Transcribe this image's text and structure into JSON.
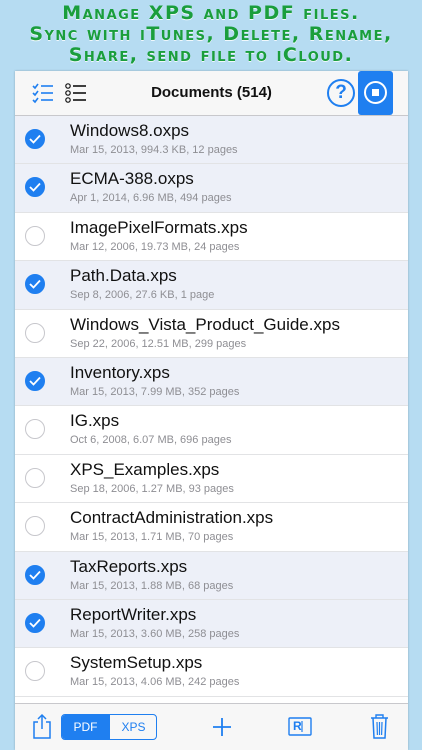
{
  "promo": {
    "line1": "Manage XPS and PDF files.",
    "line2": "Sync with iTunes, Delete, Rename,",
    "line3": "Share, send file to iCloud."
  },
  "header": {
    "title": "Documents (514)",
    "help_label": "?"
  },
  "files": [
    {
      "name": "Windows8.oxps",
      "meta": "Mar 15, 2013, 994.3 KB, 12 pages",
      "selected": true
    },
    {
      "name": "ECMA-388.oxps",
      "meta": "Apr 1, 2014, 6.96 MB, 494 pages",
      "selected": true
    },
    {
      "name": "ImagePixelFormats.xps",
      "meta": "Mar 12, 2006, 19.73 MB, 24 pages",
      "selected": false
    },
    {
      "name": "Path.Data.xps",
      "meta": "Sep 8, 2006, 27.6 KB, 1 page",
      "selected": true
    },
    {
      "name": "Windows_Vista_Product_Guide.xps",
      "meta": "Sep 22, 2006, 12.51 MB, 299 pages",
      "selected": false
    },
    {
      "name": "Inventory.xps",
      "meta": "Mar 15, 2013, 7.99 MB, 352 pages",
      "selected": true
    },
    {
      "name": "IG.xps",
      "meta": "Oct 6, 2008, 6.07 MB, 696 pages",
      "selected": false
    },
    {
      "name": "XPS_Examples.xps",
      "meta": "Sep 18, 2006, 1.27 MB, 93 pages",
      "selected": false
    },
    {
      "name": "ContractAdministration.xps",
      "meta": "Mar 15, 2013, 1.71 MB, 70 pages",
      "selected": false
    },
    {
      "name": "TaxReports.xps",
      "meta": "Mar 15, 2013, 1.88 MB, 68 pages",
      "selected": true
    },
    {
      "name": "ReportWriter.xps",
      "meta": "Mar 15, 2013, 3.60 MB, 258 pages",
      "selected": true
    },
    {
      "name": "SystemSetup.xps",
      "meta": "Mar 15, 2013, 4.06 MB, 242 pages",
      "selected": false
    }
  ],
  "toolbar": {
    "segment_pdf": "PDF",
    "segment_xps": "XPS",
    "active_segment": "PDF",
    "rename_glyph": "R"
  },
  "icons": {
    "select_all": "checklist-icon",
    "list": "numbered-list-icon",
    "help": "help-icon",
    "stop": "stop-icon",
    "share": "share-icon",
    "add": "plus-icon",
    "rename": "rename-icon",
    "delete": "trash-icon"
  },
  "colors": {
    "accent": "#1f7ff0",
    "promo_text": "#1a9e3c",
    "background": "#b6dcf2",
    "selected_row": "#edf0f8"
  }
}
